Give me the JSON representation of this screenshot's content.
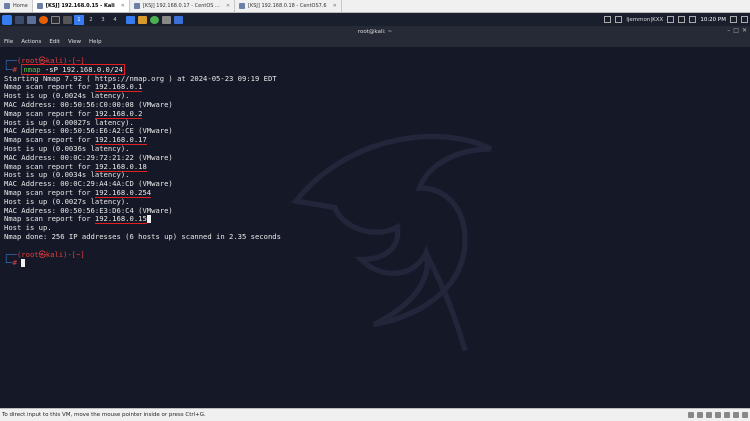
{
  "vm_tabs": [
    {
      "label": "Home",
      "active": false
    },
    {
      "label": "[KSJ] 192.168.0.15 - Kali",
      "active": true
    },
    {
      "label": "[KSJ] 192.168.0.17 - CentOS ...",
      "active": false
    },
    {
      "label": "[KSJ] 192.168.0.18 - CentOS7.6",
      "active": false
    }
  ],
  "panel": {
    "workspaces": [
      "1",
      "2",
      "3",
      "4"
    ],
    "user": "ljemmon|KXX",
    "time": "10:20 PM"
  },
  "terminal": {
    "title": "root@kali: ~",
    "menu": [
      "File",
      "Actions",
      "Edit",
      "View",
      "Help"
    ],
    "prompt_top": "(root㉿kali)-[~]",
    "prompt_symbol": "#",
    "command_name": "nmap",
    "command_flag": "-sP",
    "command_arg": "192.168.0.0/24",
    "output": {
      "start": "Starting Nmap 7.92 ( https://nmap.org ) at 2024-05-23 09:19 EDT",
      "report_prefix": "Nmap scan report for ",
      "hosts": [
        {
          "ip": "192.168.0.1",
          "up": "Host is up (0.0024s latency).",
          "mac": "MAC Address: 00:50:56:C0:00:08 (VMware)"
        },
        {
          "ip": "192.168.0.2",
          "up": "Host is up (0.00027s latency).",
          "mac": "MAC Address: 00:50:56:E6:A2:CE (VMware)"
        },
        {
          "ip": "192.168.0.17",
          "up": "Host is up (0.0036s latency).",
          "mac": "MAC Address: 00:0C:29:72:21:22 (VMware)"
        },
        {
          "ip": "192.168.0.18",
          "up": "Host is up (0.0034s latency).",
          "mac": "MAC Address: 00:0C:29:A4:4A:CD (VMware)"
        },
        {
          "ip": "192.168.0.254",
          "up": "Host is up (0.0027s latency).",
          "mac": "MAC Address: 00:50:56:E3:D6:C4 (VMware)"
        },
        {
          "ip": "192.168.0.15",
          "up": "Host is up.",
          "mac": ""
        }
      ],
      "done": "Nmap done: 256 IP addresses (6 hosts up) scanned in 2.35 seconds"
    },
    "prompt2_top": "(root㉿kali)-[~]",
    "prompt2_symbol": "#"
  },
  "statusbar": {
    "text": "To direct input to this VM, move the mouse pointer inside or press Ctrl+G."
  },
  "colors": {
    "terminal_bg": "#151927",
    "prompt_blue": "#3c7bd1",
    "prompt_red": "#ea3d3d",
    "highlight_red": "#e02020"
  }
}
